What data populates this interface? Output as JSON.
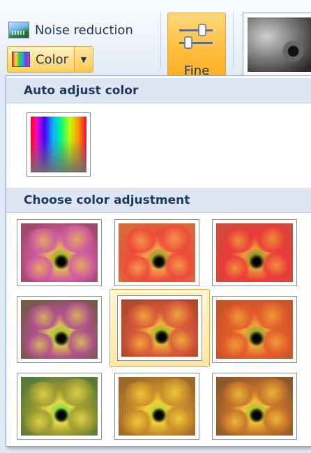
{
  "ribbon": {
    "noise_reduction_label": "Noise reduction",
    "color_label": "Color",
    "fine_label": "Fine"
  },
  "panel": {
    "auto_header": "Auto adjust color",
    "choose_header": "Choose color adjustment",
    "selected_index": 4
  },
  "colors": {
    "header_bg": "#dde6f2",
    "header_text": "#1e395b",
    "selection_border": "#e8a93c",
    "ribbon_hot": "#ffbc3b"
  },
  "icons": {
    "noise": "noise-reduction-icon",
    "color": "color-icon",
    "dropdown": "chevron-down-icon",
    "fine": "sliders-icon"
  },
  "adjustments": [
    {
      "bg": "#a04a6a",
      "petal": "#d05ca0",
      "glow": "#e5b45a",
      "center": "#98b42a"
    },
    {
      "bg": "#d86a3a",
      "petal": "#ee4a3a",
      "glow": "#f4a14a",
      "center": "#96a02a"
    },
    {
      "bg": "#cf4a3a",
      "petal": "#ea3a3a",
      "glow": "#f19a3a",
      "center": "#8a9a2a"
    },
    {
      "bg": "#7a5a4a",
      "petal": "#b0508a",
      "glow": "#d8c05a",
      "center": "#a8c430"
    },
    {
      "bg": "#b04a2a",
      "petal": "#d8583a",
      "glow": "#f0b23a",
      "center": "#a0b828"
    },
    {
      "bg": "#c4562a",
      "petal": "#e25a2a",
      "glow": "#f0a43a",
      "center": "#98a82a"
    },
    {
      "bg": "#5a7a3a",
      "petal": "#9a9a30",
      "glow": "#e8d84a",
      "center": "#7ee04a"
    },
    {
      "bg": "#9a6a2a",
      "petal": "#c88a2a",
      "glow": "#f2d23a",
      "center": "#b8d830"
    },
    {
      "bg": "#8a5a2a",
      "petal": "#c4702a",
      "glow": "#f0c03a",
      "center": "#a8c430"
    }
  ]
}
